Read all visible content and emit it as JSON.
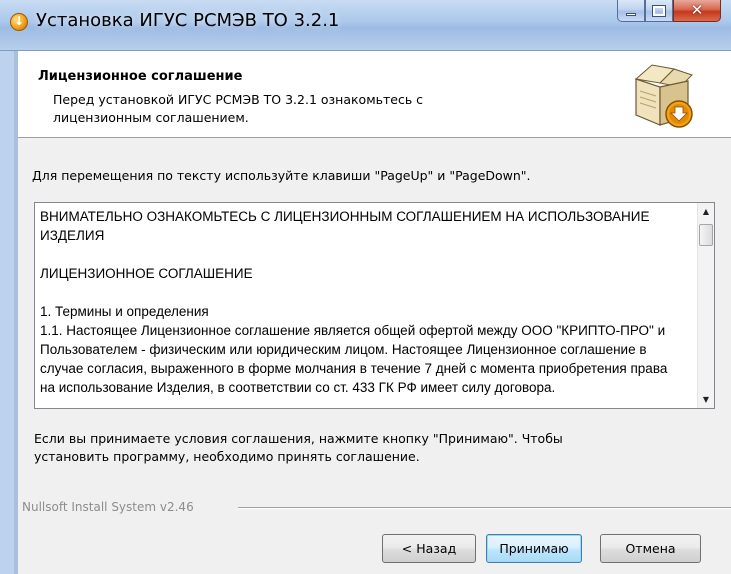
{
  "window": {
    "title": "Установка ИГУС РСМЭВ ТО 3.2.1",
    "controls": {
      "minimize": "minimize",
      "maximize": "maximize",
      "close": "close"
    }
  },
  "header": {
    "title": "Лицензионное соглашение",
    "subtitle": "Перед установкой ИГУС РСМЭВ ТО 3.2.1 ознакомьтесь с лицензионным соглашением.",
    "icon": "installer-box-icon"
  },
  "body": {
    "hint": "Для перемещения по тексту используйте клавиши \"PageUp\" и \"PageDown\".",
    "license_lines": [
      "ВНИМАТЕЛЬНО ОЗНАКОМЬТЕСЬ С ЛИЦЕНЗИОННЫМ СОГЛАШЕНИЕМ НА ИСПОЛЬЗОВАНИЕ ИЗДЕЛИЯ",
      "ЛИЦЕНЗИОННОЕ СОГЛАШЕНИЕ",
      "1. Термины и определения",
      "1.1. Настоящее Лицензионное соглашение является общей офертой между ООО \"КРИПТО-ПРО\" и Пользователем - физическим или юридическим лицом. Настоящее Лицензионное соглашение в случае согласия, выраженного в форме молчания в течение 7 дней с момента приобретения права на использование Изделия, в соответствии со ст. 433 ГК РФ имеет силу договора."
    ],
    "accept_note": "Если вы принимаете условия соглашения, нажмите кнопку \"Принимаю\". Чтобы установить программу, необходимо принять соглашение."
  },
  "footer": {
    "branding": "Nullsoft Install System v2.46",
    "buttons": {
      "back": "< Назад",
      "accept": "Принимаю",
      "cancel": "Отмена"
    }
  },
  "colors": {
    "titlebar": "#a9c6ea",
    "close_button": "#c5381b",
    "dialog_bg": "#f0f0f0",
    "default_button_border": "#3c7fb1"
  }
}
